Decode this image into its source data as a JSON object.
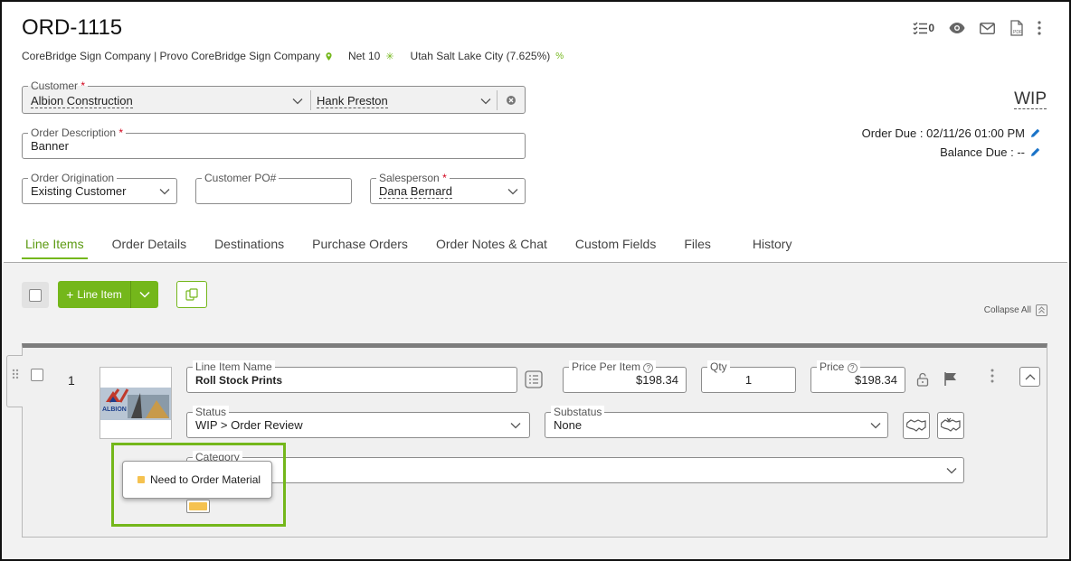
{
  "header": {
    "order_id": "ORD-1115",
    "company": "CoreBridge Sign Company | Provo CoreBridge Sign Company",
    "terms": "Net 10",
    "tax": "Utah Salt Lake City (7.625%)",
    "status": "WIP",
    "checklist_count": "0",
    "pdf_label": "PDF",
    "order_due": "Order Due : 02/11/26 01:00 PM",
    "balance_due": "Balance Due : --"
  },
  "form": {
    "customer_label": "Customer",
    "customer_value": "Albion Construction",
    "contact_value": "Hank Preston",
    "description_label": "Order Description",
    "description_value": "Banner",
    "origination_label": "Order Origination",
    "origination_value": "Existing Customer",
    "po_label": "Customer PO#",
    "po_value": "",
    "salesperson_label": "Salesperson",
    "salesperson_value": "Dana Bernard",
    "required_mark": "*"
  },
  "tabs": [
    {
      "label": "Line Items"
    },
    {
      "label": "Order Details"
    },
    {
      "label": "Destinations"
    },
    {
      "label": "Purchase Orders"
    },
    {
      "label": "Order Notes & Chat"
    },
    {
      "label": "Custom Fields"
    },
    {
      "label": "Files"
    },
    {
      "label": "History"
    }
  ],
  "toolbar": {
    "add_line_item_label": "Line Item",
    "plus": "+",
    "collapse_all_label": "Collapse All"
  },
  "line_item": {
    "number": "1",
    "name_label": "Line Item Name",
    "name_value": "Roll Stock Prints",
    "price_per_item_label": "Price Per Item",
    "price_per_item_value": "$198.34",
    "qty_label": "Qty",
    "qty_value": "1",
    "price_label": "Price",
    "price_value": "$198.34",
    "status_label": "Status",
    "status_value": "WIP > Order Review",
    "substatus_label": "Substatus",
    "substatus_value": "None",
    "category_label": "Category",
    "category_tooltip": "Need to Order Material",
    "thumbnail_text": "ALBION",
    "category_color": "#f5c250"
  },
  "colors": {
    "accent": "#74b71b",
    "required": "#d0021b",
    "link_blue": "#1a73c8"
  }
}
